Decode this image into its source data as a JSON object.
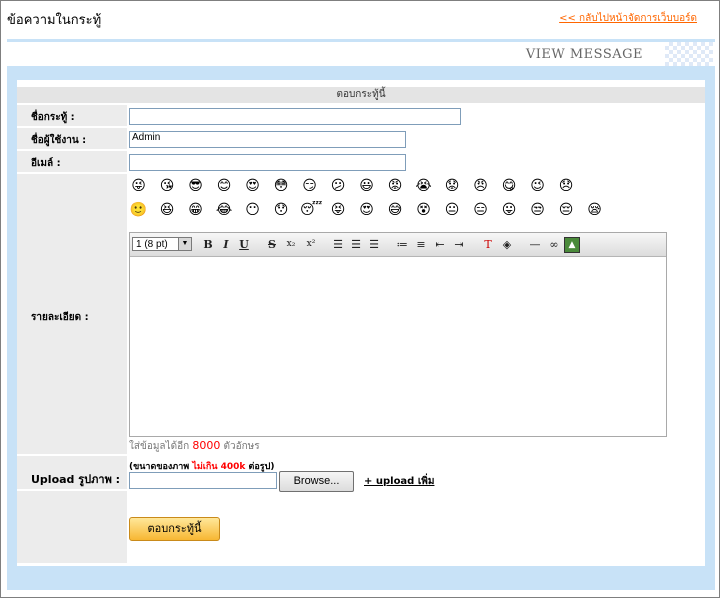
{
  "page_title": "ข้อความในกระทู้",
  "back_link": "<< กลับไปหน้าจัดการเว็บบอร์ด",
  "header": {
    "view_label": "VIEW MESSAGE"
  },
  "form": {
    "section_title": "ตอบกระทู้นี้",
    "topic_label": "ชื่อกระทู้ :",
    "topic_value": "",
    "user_label": "ชื่อผู้ใช้งาน :",
    "user_value": "Admin",
    "email_label": "อีเมล์ :",
    "email_value": "",
    "detail_label": "รายละเอียด :",
    "remaining_prefix": "ใส่ข้อมูลได้อีก",
    "remaining_count": "8000",
    "remaining_suffix": "ตัวอักษร"
  },
  "emoticons": [
    "emoticon-1",
    "emoticon-2",
    "emoticon-3",
    "emoticon-4",
    "emoticon-5",
    "emoticon-6",
    "emoticon-7",
    "emoticon-8",
    "emoticon-9",
    "emoticon-10",
    "emoticon-11",
    "emoticon-12",
    "emoticon-13",
    "emoticon-14",
    "emoticon-15",
    "emoticon-16",
    "emoticon-17",
    "emoticon-18",
    "emoticon-19",
    "emoticon-20",
    "emoticon-21",
    "emoticon-22",
    "emoticon-23",
    "emoticon-24",
    "emoticon-25",
    "emoticon-26",
    "emoticon-27",
    "emoticon-28",
    "emoticon-29",
    "emoticon-30",
    "emoticon-31",
    "emoticon-32",
    "emoticon-33"
  ],
  "editor": {
    "font_size": "1 (8 pt)",
    "bold": "B",
    "italic": "I",
    "underline": "U",
    "strike": "S",
    "subscript": "x₂",
    "superscript": "x²"
  },
  "upload": {
    "label": "Upload รูปภาพ :",
    "note_prefix": "(ขนาดของภาพ",
    "note_limit": "ไม่เกิน 400k",
    "note_suffix": "ต่อรูป)",
    "browse_label": "Browse...",
    "more_label": "+ upload เพิ่ม"
  },
  "submit_label": "ตอบกระทู้นี้",
  "colors": {
    "panel_blue": "#c8e2f7",
    "label_gray": "#ececec",
    "link_orange": "#ff6600",
    "accent_red": "#ff0000"
  }
}
